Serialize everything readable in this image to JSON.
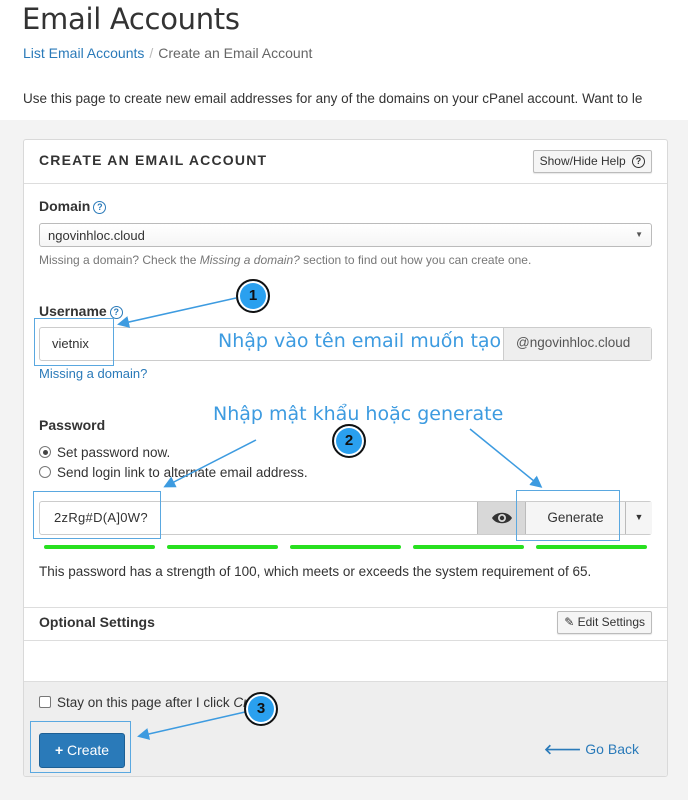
{
  "page": {
    "title": "Email Accounts",
    "intro": "Use this page to create new email addresses for any of the domains on your cPanel account. Want to le"
  },
  "breadcrumb": {
    "parent": "List Email Accounts",
    "separator": "/",
    "current": "Create an Email Account"
  },
  "panel": {
    "title": "CREATE AN EMAIL ACCOUNT",
    "help_button": "Show/Hide Help",
    "domain": {
      "label": "Domain",
      "selected": "ngovinhloc.cloud",
      "hint_prefix": "Missing a domain? Check the ",
      "hint_em": "Missing a domain?",
      "hint_suffix": " section to find out how you can create one."
    },
    "username": {
      "label": "Username",
      "value": "vietnix",
      "suffix": "@ngovinhloc.cloud",
      "missing_link": "Missing a domain?"
    },
    "password": {
      "label": "Password",
      "option_set": "Set password now.",
      "option_link": "Send login link to alternate email address.",
      "value": "2zRg#D(A]0W?",
      "generate": "Generate",
      "strength_text": "This password has a strength of 100, which meets or exceeds the system requirement of 65.",
      "strength_percent": 100
    },
    "optional": {
      "label": "Optional Settings",
      "edit_button": "Edit Settings"
    },
    "footer": {
      "stay_label_prefix": "Stay on this page after I click ",
      "stay_label_em": "Create",
      "stay_label_suffix": ".",
      "create_button": "Create",
      "go_back": "Go Back"
    }
  },
  "annotations": {
    "note_username": "Nhập vào tên email muốn tạo",
    "note_password": "Nhập mật khẩu hoặc generate",
    "step1": "1",
    "step2": "2",
    "step3": "3",
    "color": "#3d9be0"
  },
  "colors": {
    "link": "#2a7ab9",
    "primary": "#2a7ab9",
    "strength_bar": "#28e020"
  }
}
